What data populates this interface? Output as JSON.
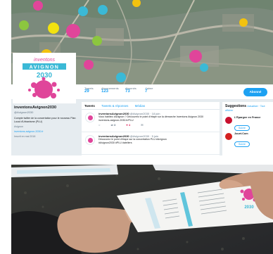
{
  "twitter": {
    "profile_name": "inventonsAvignon2030",
    "handle": "@Avignon2030",
    "bio": "Compte twitter de la concertation pour le nouveau Plan Local d'Urbanisme (PLU)",
    "location": "Avignon",
    "website": "inventons-avignon-2030.fr",
    "joined": "Inscrit en mai 2018",
    "logo_top": "inventons",
    "logo_mid": "AVIGNON",
    "logo_year": "2030",
    "stats": [
      {
        "label": "Tweets",
        "value": "29"
      },
      {
        "label": "Abonnements",
        "value": "123"
      },
      {
        "label": "Abonnés",
        "value": "73"
      },
      {
        "label": "J'aime",
        "value": "7"
      }
    ],
    "follow_label": "Abonné",
    "tabs": [
      "Tweets",
      "Tweets & réponses",
      "Médias"
    ],
    "tweets": [
      {
        "author": "inventonsAvignon2030",
        "meta": "@Avignon2030 · 18 juin",
        "text": "Vous habitez #Avignon ? Découvrez le point d'étape sur la démarche Inventons Avignon 2030",
        "link": "inventons-avignon-2030.fr/PLU",
        "replies": "",
        "retweets": "3",
        "likes": "4"
      },
      {
        "author": "inventonsAvignon2030",
        "meta": "@Avignon2030 · 5 juin",
        "text": "Découvrez le point d'étape sur la concertation PLU #Avignon",
        "link": "#Avignon2030 #PLU #ateliers",
        "replies": "",
        "retweets": "",
        "likes": ""
      }
    ],
    "suggestions_title": "Suggestions",
    "suggestions_links": "Actualiser · Tout afficher",
    "suggestions": [
      {
        "name": "L'Épargne en France",
        "button": "Suivre"
      },
      {
        "name": "Jouet.Com",
        "button": "Suivre"
      }
    ]
  },
  "colors": {
    "twitter_blue": "#1da1f2",
    "brand_pink": "#e0459a",
    "brand_cyan": "#3bb9d6",
    "paper": "#f4f4f2"
  },
  "leaflet": {
    "logo_year": "2030"
  }
}
